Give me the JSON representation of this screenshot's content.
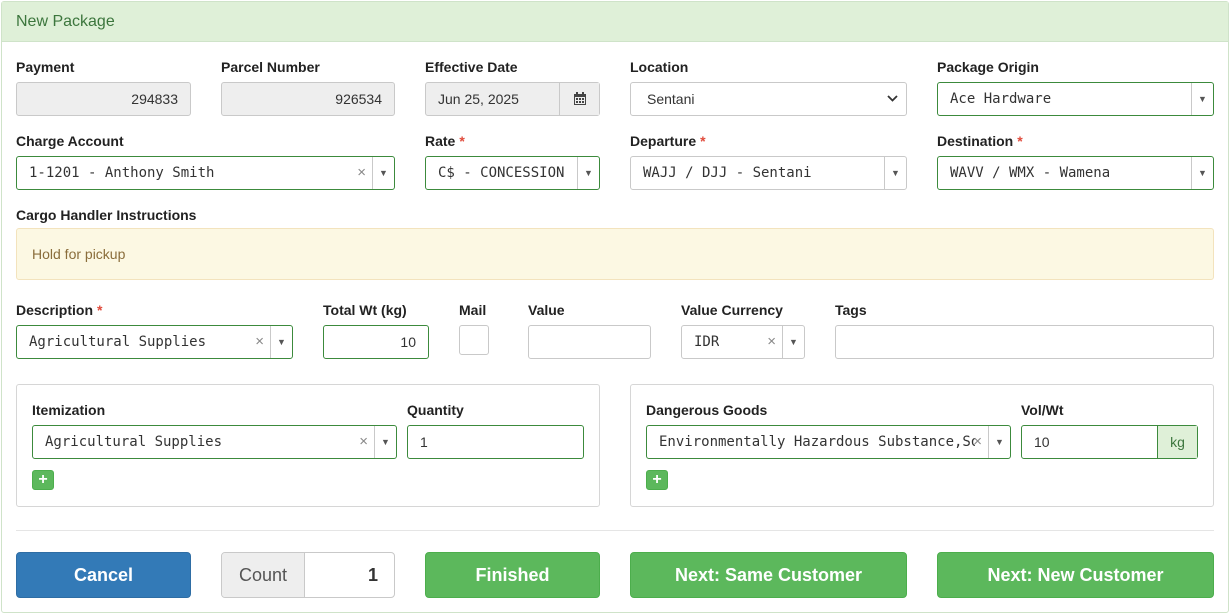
{
  "panel": {
    "title": "New Package"
  },
  "payment": {
    "label": "Payment",
    "value": "294833"
  },
  "parcel_number": {
    "label": "Parcel Number",
    "value": "926534"
  },
  "effective_date": {
    "label": "Effective Date",
    "value": "Jun 25, 2025"
  },
  "location": {
    "label": "Location",
    "value": "Sentani"
  },
  "package_origin": {
    "label": "Package Origin",
    "value": "Ace Hardware"
  },
  "charge_account": {
    "label": "Charge Account",
    "value": "1-1201 - Anthony Smith"
  },
  "rate": {
    "label": "Rate",
    "required": "*",
    "value": "C$ - CONCESSION"
  },
  "departure": {
    "label": "Departure",
    "required": "*",
    "value": "WAJJ / DJJ - Sentani"
  },
  "destination": {
    "label": "Destination",
    "required": "*",
    "value": "WAVV / WMX - Wamena"
  },
  "cargo_instructions": {
    "label": "Cargo Handler Instructions",
    "value": "Hold for pickup"
  },
  "description": {
    "label": "Description",
    "required": "*",
    "value": "Agricultural Supplies"
  },
  "total_wt": {
    "label": "Total Wt (kg)",
    "value": "10"
  },
  "mail": {
    "label": "Mail",
    "checked": false
  },
  "value_field": {
    "label": "Value",
    "value": ""
  },
  "value_currency": {
    "label": "Value Currency",
    "value": "IDR"
  },
  "tags": {
    "label": "Tags",
    "value": ""
  },
  "itemization": {
    "label": "Itemization",
    "quantity_label": "Quantity",
    "item_value": "Agricultural Supplies",
    "quantity_value": "1",
    "add_label": "+"
  },
  "dangerous_goods": {
    "label": "Dangerous Goods",
    "vol_wt_label": "Vol/Wt",
    "item_value": "Environmentally Hazardous Substance,Sol…",
    "vol_wt_value": "10",
    "unit": "kg",
    "add_label": "+"
  },
  "footer": {
    "cancel": "Cancel",
    "count_label": "Count",
    "count_value": "1",
    "finished": "Finished",
    "next_same": "Next: Same Customer",
    "next_new": "Next: New Customer"
  },
  "icons": {
    "calendar": "calendar-icon",
    "clear": "×",
    "caret": "▼"
  },
  "colors": {
    "header_bg": "#dff0d8",
    "header_text": "#3c763d",
    "primary_blue": "#337ab7",
    "success_green": "#5cb85c",
    "required_red": "#e04a3b",
    "notes_bg": "#fcf8e3"
  }
}
